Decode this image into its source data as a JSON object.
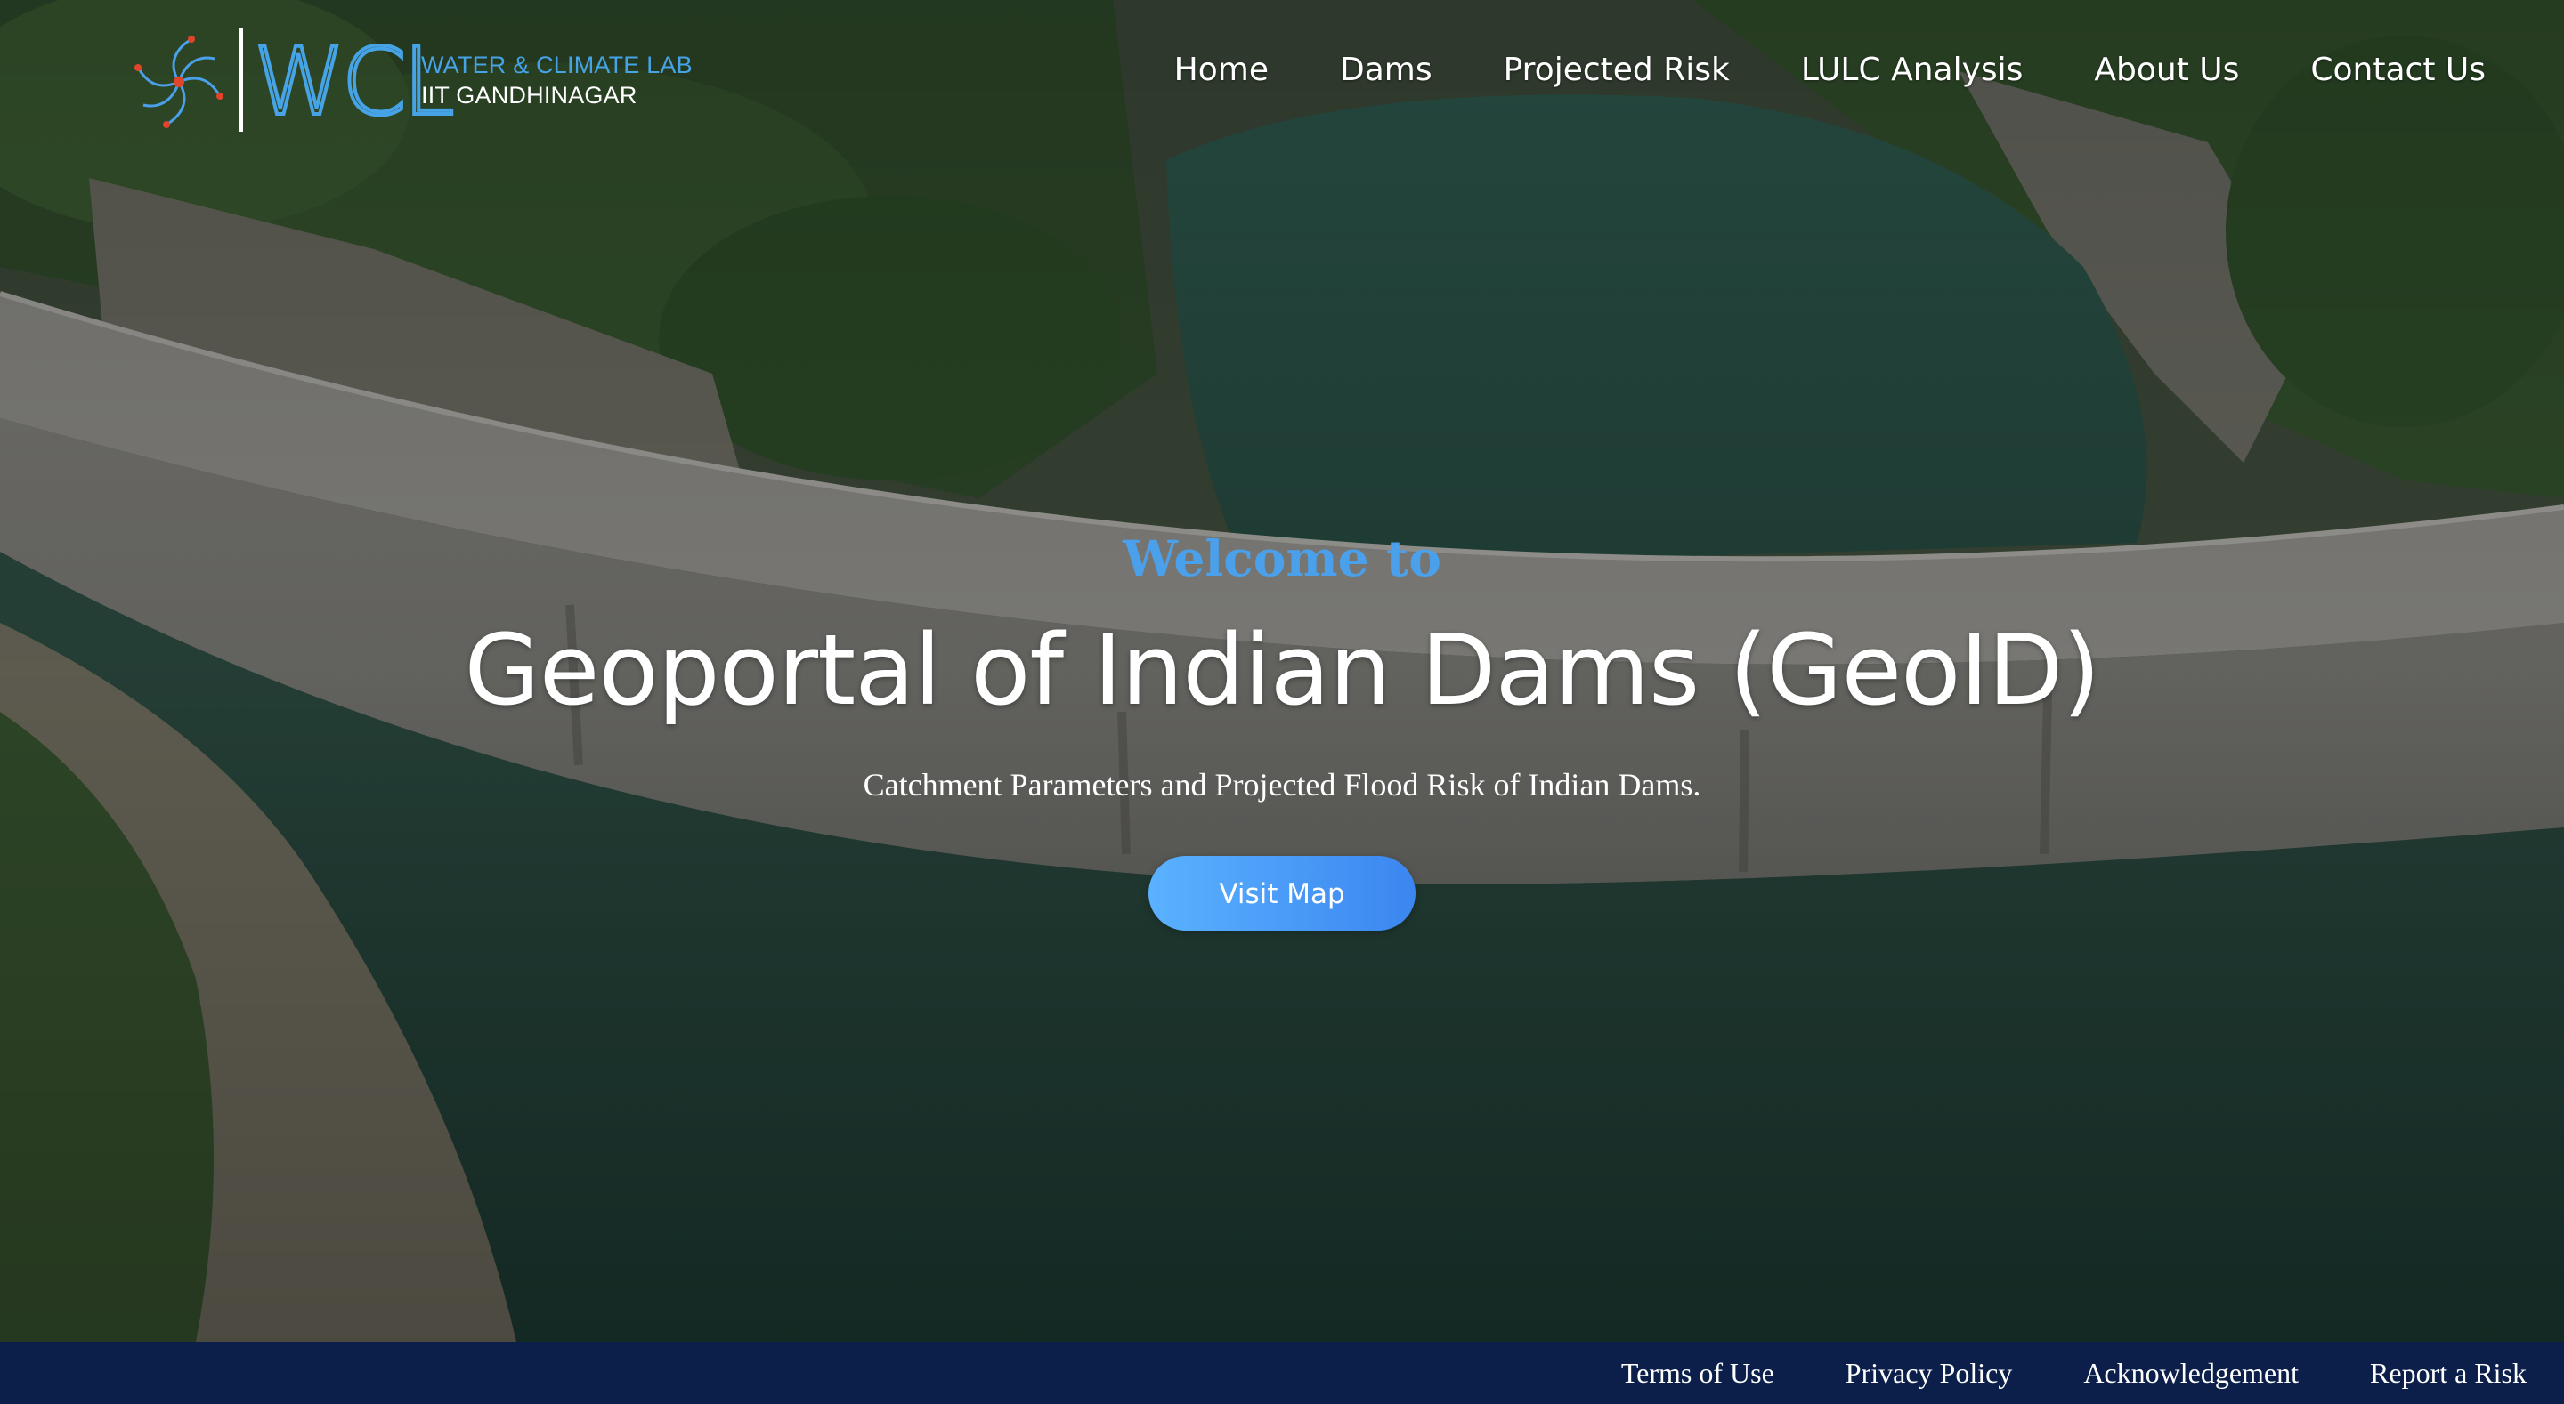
{
  "header": {
    "logo": {
      "mark": "WCL",
      "line1": "WATER & CLIMATE LAB",
      "line2": "IIT GANDHINAGAR",
      "accent_color": "#45a3e6"
    },
    "nav": [
      {
        "label": "Home"
      },
      {
        "label": "Dams"
      },
      {
        "label": "Projected Risk"
      },
      {
        "label": "LULC Analysis"
      },
      {
        "label": "About Us"
      },
      {
        "label": "Contact Us"
      }
    ]
  },
  "hero": {
    "welcome": "Welcome to",
    "title": "Geoportal of Indian Dams (GeoID)",
    "subtitle": "Catchment Parameters and Projected Flood Risk of Indian Dams.",
    "cta_label": "Visit Map",
    "welcome_color": "#4aa0ea",
    "cta_gradient": [
      "#5ab2ff",
      "#3b86f0"
    ],
    "background": "aerial-dam-reservoir-photo"
  },
  "footer": {
    "background_color": "#0b1f4a",
    "links": [
      {
        "label": "Terms of Use"
      },
      {
        "label": "Privacy Policy"
      },
      {
        "label": "Acknowledgement"
      },
      {
        "label": "Report a Risk"
      }
    ]
  }
}
